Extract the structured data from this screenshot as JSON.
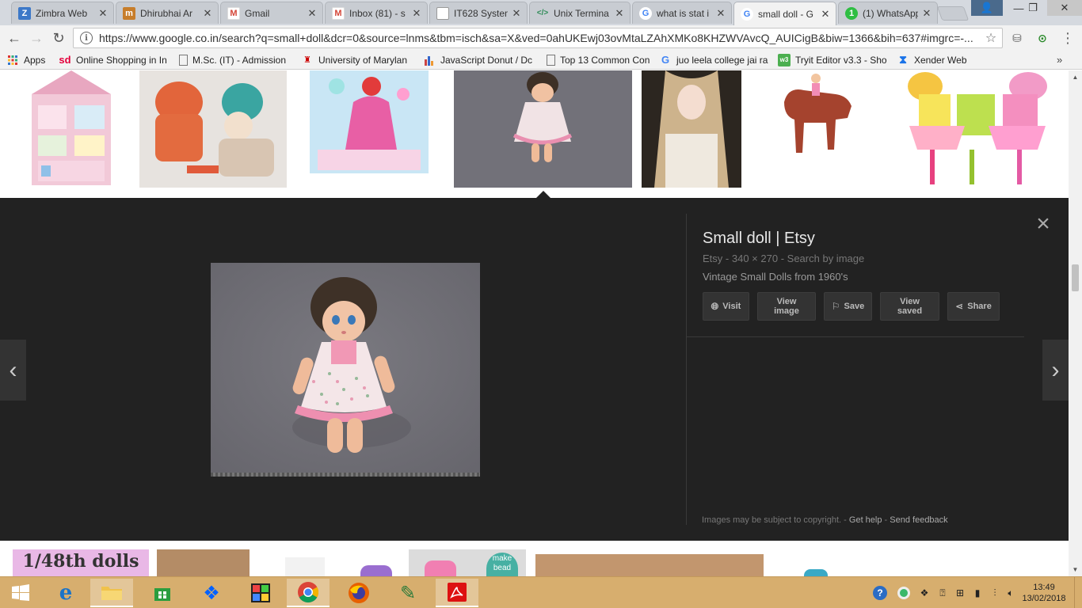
{
  "tabs": [
    {
      "title": "Zimbra Web",
      "favicon": "Z",
      "color": "#3c78c8"
    },
    {
      "title": "Dhirubhai Ar",
      "favicon": "m",
      "color": "#c77d2a"
    },
    {
      "title": "Gmail",
      "favicon": "M",
      "color": "#d44638"
    },
    {
      "title": "Inbox (81) - s",
      "favicon": "M",
      "color": "#d44638"
    },
    {
      "title": "IT628 System",
      "favicon": "",
      "color": "#888888"
    },
    {
      "title": "Unix Termina",
      "favicon": "</>",
      "color": "#2e8b57"
    },
    {
      "title": "what is stat i",
      "favicon": "G",
      "color": "#4285f4"
    },
    {
      "title": "small doll - G",
      "favicon": "G",
      "color": "#4285f4"
    },
    {
      "title": "(1) WhatsApp",
      "favicon": "1",
      "color": "#2fbe43"
    }
  ],
  "toolbar": {
    "url": "https://www.google.co.in/search?q=small+doll&dcr=0&source=lnms&tbm=isch&sa=X&ved=0ahUKEwj03ovMtaLZAhXMKo8KHZWVAvcQ_AUICigB&biw=1366&bih=637#imgrc=-..."
  },
  "bookmarks": [
    {
      "label": "Apps",
      "icon": "apps-icon"
    },
    {
      "label": "Online Shopping in In",
      "icon": "sd-icon"
    },
    {
      "label": "M.Sc. (IT) - Admission",
      "icon": "page-icon"
    },
    {
      "label": "University of Marylan",
      "icon": "umd-icon"
    },
    {
      "label": "JavaScript Donut / Dc",
      "icon": "chart-icon"
    },
    {
      "label": "Top 13 Common Con",
      "icon": "page-icon"
    },
    {
      "label": "juo leela college jai ra",
      "icon": "google-icon"
    },
    {
      "label": "Tryit Editor v3.3 - Sho",
      "icon": "w3-icon"
    },
    {
      "label": "Xender Web",
      "icon": "xender-icon"
    }
  ],
  "thumbnails_bottom": {
    "first_label": "1/48th dolls",
    "make_label": "make",
    "bead_label": "bead"
  },
  "preview": {
    "title": "Small doll | Etsy",
    "source": "Etsy",
    "dims": "340 × 270",
    "search_by_image": "Search by image",
    "description": "Vintage Small Dolls from 1960's",
    "actions": [
      {
        "label": "Visit",
        "icon": "globe-icon"
      },
      {
        "label": "View image",
        "icon": ""
      },
      {
        "label": "Save",
        "icon": "bookmark-icon"
      },
      {
        "label": "View saved",
        "icon": ""
      },
      {
        "label": "Share",
        "icon": "share-icon"
      }
    ],
    "footer_notice": "Images may be subject to copyright.",
    "get_help": "Get help",
    "send_feedback": "Send feedback"
  },
  "clock": {
    "time": "13:49",
    "date": "13/02/2018"
  }
}
